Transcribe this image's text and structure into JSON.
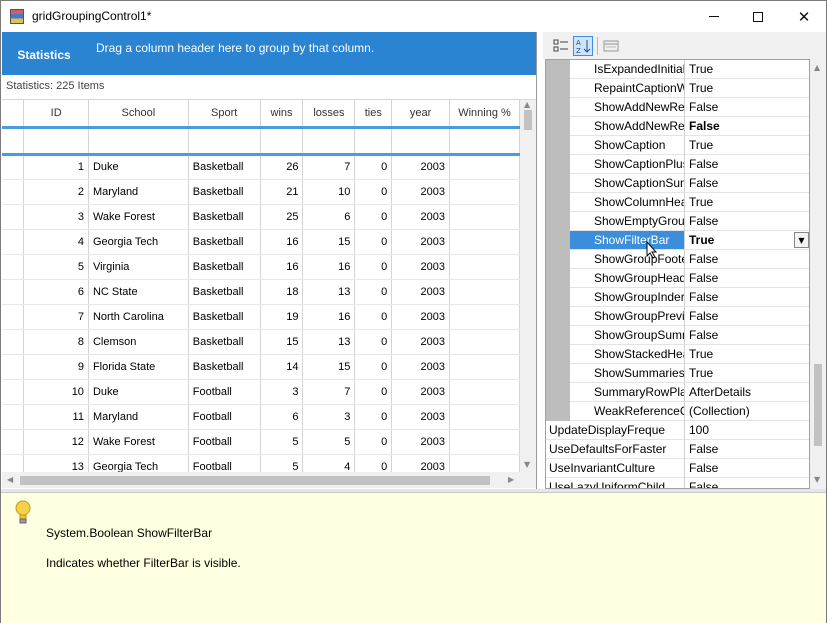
{
  "window": {
    "title": "gridGroupingControl1*",
    "minimize_glyph": "",
    "close_glyph": "✕"
  },
  "grid": {
    "tab_label": "Statistics",
    "drop_hint": "Drag a column header here to group by that column.",
    "caption": "Statistics: 225 Items",
    "columns": [
      "ID",
      "School",
      "Sport",
      "wins",
      "losses",
      "ties",
      "year",
      "Winning %"
    ],
    "rows": [
      [
        "1",
        "Duke",
        "Basketball",
        "26",
        "7",
        "0",
        "2003",
        ""
      ],
      [
        "2",
        "Maryland",
        "Basketball",
        "21",
        "10",
        "0",
        "2003",
        ""
      ],
      [
        "3",
        "Wake Forest",
        "Basketball",
        "25",
        "6",
        "0",
        "2003",
        ""
      ],
      [
        "4",
        "Georgia Tech",
        "Basketball",
        "16",
        "15",
        "0",
        "2003",
        ""
      ],
      [
        "5",
        "Virginia",
        "Basketball",
        "16",
        "16",
        "0",
        "2003",
        ""
      ],
      [
        "6",
        "NC State",
        "Basketball",
        "18",
        "13",
        "0",
        "2003",
        ""
      ],
      [
        "7",
        "North Carolina",
        "Basketball",
        "19",
        "16",
        "0",
        "2003",
        ""
      ],
      [
        "8",
        "Clemson",
        "Basketball",
        "15",
        "13",
        "0",
        "2003",
        ""
      ],
      [
        "9",
        "Florida State",
        "Basketball",
        "14",
        "15",
        "0",
        "2003",
        ""
      ],
      [
        "10",
        "Duke",
        "Football",
        "3",
        "7",
        "0",
        "2003",
        ""
      ],
      [
        "11",
        "Maryland",
        "Football",
        "6",
        "3",
        "0",
        "2003",
        ""
      ],
      [
        "12",
        "Wake Forest",
        "Football",
        "5",
        "5",
        "0",
        "2003",
        ""
      ],
      [
        "13",
        "Georgia Tech",
        "Football",
        "5",
        "4",
        "0",
        "2003",
        ""
      ]
    ]
  },
  "property_grid": {
    "toolbar": {
      "categorized_icon": "categorized-icon",
      "alphabetical_icon": "alphabetical-icon",
      "property_pages_icon": "property-pages-icon"
    },
    "rows": [
      {
        "name": "IsExpandedInitiall",
        "value": "True",
        "indent": true
      },
      {
        "name": "RepaintCaptionW",
        "value": "True",
        "indent": true
      },
      {
        "name": "ShowAddNewRec",
        "value": "False",
        "indent": true
      },
      {
        "name": "ShowAddNewRec",
        "value": "False",
        "indent": true,
        "bold": true
      },
      {
        "name": "ShowCaption",
        "value": "True",
        "indent": true
      },
      {
        "name": "ShowCaptionPlus",
        "value": "False",
        "indent": true
      },
      {
        "name": "ShowCaptionSum",
        "value": "False",
        "indent": true
      },
      {
        "name": "ShowColumnHea",
        "value": "True",
        "indent": true
      },
      {
        "name": "ShowEmptyGrou",
        "value": "False",
        "indent": true
      },
      {
        "name": "ShowFilterBar",
        "value": "True",
        "indent": true,
        "bold": true,
        "selected": true
      },
      {
        "name": "ShowGroupFoote",
        "value": "False",
        "indent": true
      },
      {
        "name": "ShowGroupHead",
        "value": "False",
        "indent": true
      },
      {
        "name": "ShowGroupInder",
        "value": "False",
        "indent": true
      },
      {
        "name": "ShowGroupPrevi",
        "value": "False",
        "indent": true
      },
      {
        "name": "ShowGroupSumr",
        "value": "False",
        "indent": true
      },
      {
        "name": "ShowStackedHea",
        "value": "True",
        "indent": true
      },
      {
        "name": "ShowSummaries",
        "value": "True",
        "indent": true
      },
      {
        "name": "SummaryRowPla",
        "value": "AfterDetails",
        "indent": true
      },
      {
        "name": "WeakReferenceC",
        "value": "(Collection)",
        "indent": true
      },
      {
        "name": "UpdateDisplayFreque",
        "value": "100",
        "indent": false
      },
      {
        "name": "UseDefaultsForFaster",
        "value": "False",
        "indent": false
      },
      {
        "name": "UseInvariantCulture",
        "value": "False",
        "indent": false
      },
      {
        "name": "UseLazyUniformChild",
        "value": "False",
        "indent": false
      }
    ]
  },
  "description": {
    "title": "System.Boolean ShowFilterBar",
    "body": "Indicates whether FilterBar is visible."
  }
}
